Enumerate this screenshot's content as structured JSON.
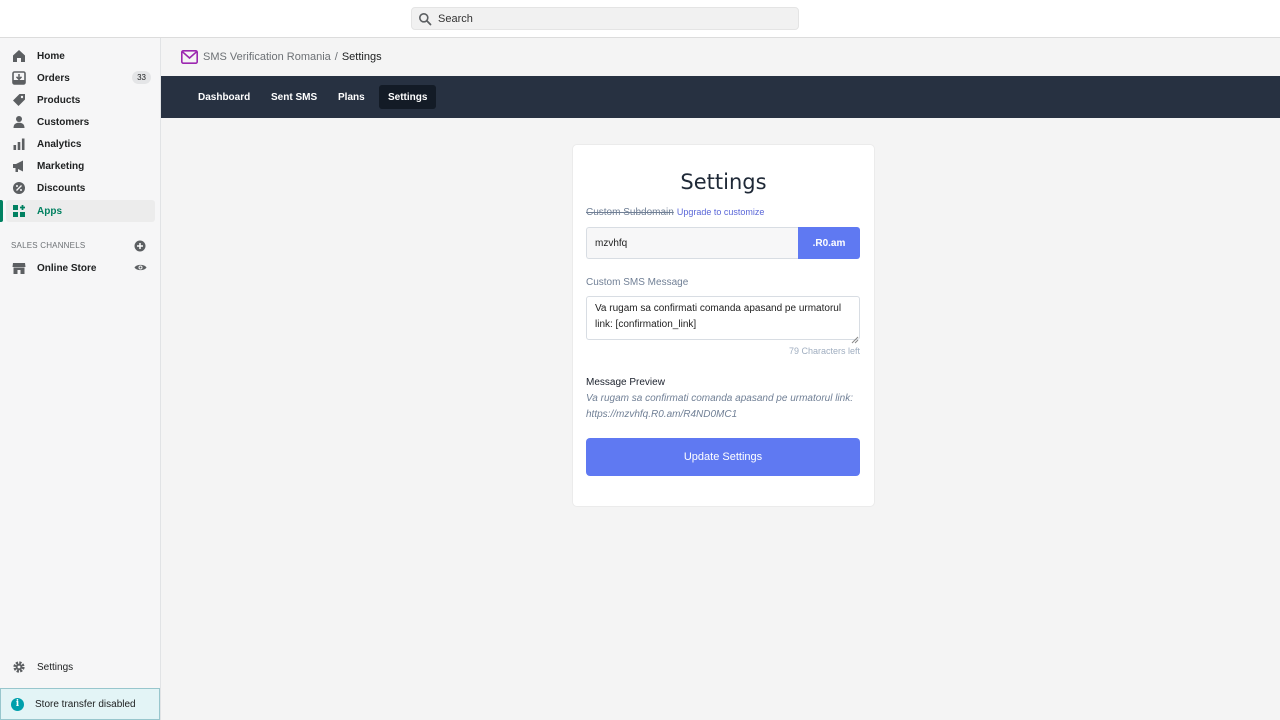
{
  "search": {
    "placeholder": "Search"
  },
  "sidebar": {
    "items": [
      {
        "label": "Home",
        "icon": "home-icon"
      },
      {
        "label": "Orders",
        "icon": "orders-icon",
        "badge": "33"
      },
      {
        "label": "Products",
        "icon": "tag-icon"
      },
      {
        "label": "Customers",
        "icon": "person-icon"
      },
      {
        "label": "Analytics",
        "icon": "bar-chart-icon"
      },
      {
        "label": "Marketing",
        "icon": "megaphone-icon"
      },
      {
        "label": "Discounts",
        "icon": "discount-icon"
      },
      {
        "label": "Apps",
        "icon": "apps-icon",
        "active": true
      }
    ],
    "sales_channels_label": "SALES CHANNELS",
    "online_store_label": "Online Store",
    "settings_label": "Settings",
    "store_transfer_label": "Store transfer disabled"
  },
  "breadcrumb": {
    "app": "SMS Verification Romania",
    "separator": "/",
    "current": "Settings"
  },
  "tabs": [
    {
      "label": "Dashboard"
    },
    {
      "label": "Sent SMS"
    },
    {
      "label": "Plans"
    },
    {
      "label": "Settings",
      "active": true
    }
  ],
  "card": {
    "title": "Settings",
    "subdomain_label": "Custom Subdomain",
    "upgrade_link": "Upgrade to customize",
    "subdomain_value": "mzvhfq",
    "subdomain_suffix": ".R0.am",
    "sms_label": "Custom SMS Message",
    "sms_value": "Va rugam sa confirmati comanda apasand pe urmatorul link: [confirmation_link]",
    "chars_left": "79 Characters left",
    "preview_label": "Message Preview",
    "preview_text": "Va rugam sa confirmati comanda apasand pe urmatorul link: https://mzvhfq.R0.am/R4ND0MC1",
    "update_button": "Update Settings"
  },
  "colors": {
    "accent": "#5f79f2",
    "nav_active": "#008060",
    "appbar": "#273141"
  }
}
